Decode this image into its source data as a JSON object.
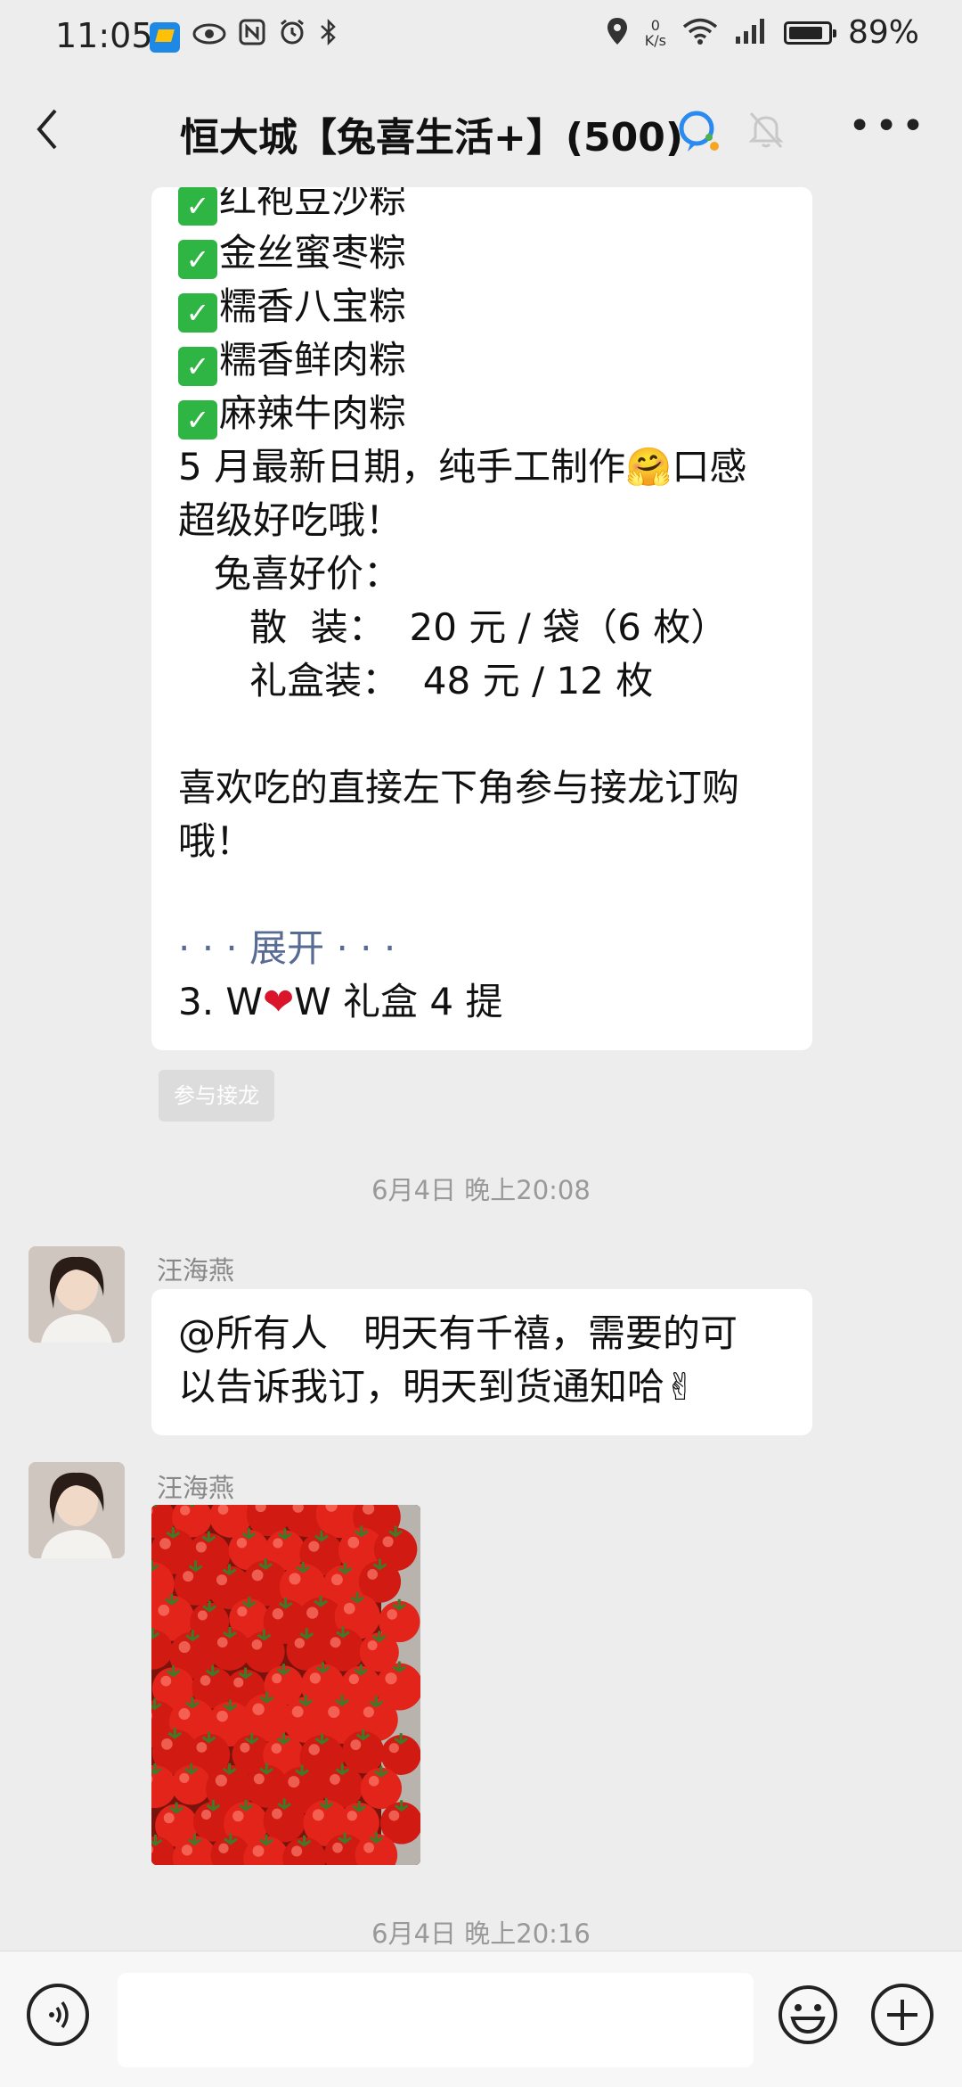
{
  "status_bar": {
    "time": "11:05",
    "net_speed_value": "0",
    "net_speed_unit": "K/s",
    "battery_text": "89%",
    "battery_level": 0.89,
    "icons": [
      "app-icon",
      "eye-icon",
      "nfc-icon",
      "alarm-icon",
      "bluetooth-icon",
      "location-icon",
      "wifi-icon",
      "signal-icon",
      "battery-icon"
    ]
  },
  "header": {
    "title": "恒大城【兔喜生活+】(500)",
    "icons": [
      "back-icon",
      "ai-assistant-icon",
      "mute-icon",
      "more-icon"
    ]
  },
  "messages": {
    "m1": {
      "lines": [
        {
          "check": true,
          "text": "红袍豆沙粽"
        },
        {
          "check": true,
          "text": "金丝蜜枣粽"
        },
        {
          "check": true,
          "text": "糯香八宝粽"
        },
        {
          "check": true,
          "text": "糯香鲜肉粽"
        },
        {
          "check": true,
          "text": "麻辣牛肉粽"
        }
      ],
      "line6a": "5 月最新日期，纯手工制作",
      "emoji6": "🤗",
      "line6b": "口感",
      "line7": "超级好吃哦！",
      "line8": "   兔喜好价：",
      "line9": "      散  装：  20 元 / 袋（6 枚）",
      "line10": "      礼盒装：  48 元 / 12 枚",
      "line11": "喜欢吃的直接左下角参与接龙订购",
      "line12": "哦！",
      "expand": "· · · 展开 · · ·",
      "line13a": "3. W",
      "heart": "❤",
      "line13b": "W 礼盒 4 提"
    },
    "join_button": "参与接龙",
    "time1": "6月4日 晚上20:08",
    "m2": {
      "sender": "汪海燕",
      "line1": "@所有人   明天有千禧，需要的可",
      "line2a": "以告诉我订，明天到货通知哈",
      "emoji": "✌"
    },
    "m3": {
      "sender": "汪海燕",
      "image": "cherry-tomatoes-photo"
    },
    "time2": "6月4日 晚上20:16"
  },
  "input_bar": {
    "placeholder": "",
    "icons": [
      "voice-icon",
      "emoji-icon",
      "plus-icon"
    ]
  }
}
